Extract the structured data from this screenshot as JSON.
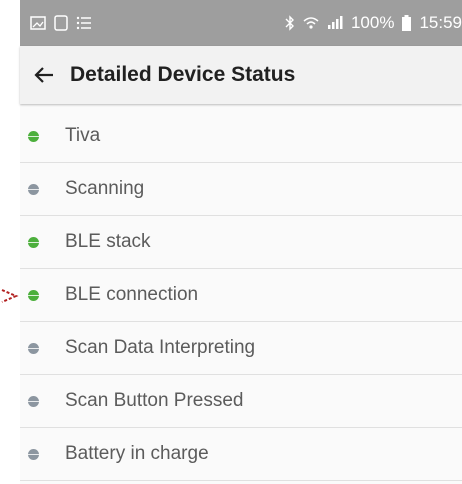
{
  "statusbar": {
    "battery": "100%",
    "time": "15:59",
    "icons_left": [
      "image-icon",
      "notification-icon",
      "menu-list-icon"
    ],
    "icons_right": [
      "bluetooth-icon",
      "wifi-icon",
      "signal-icon",
      "battery-icon"
    ]
  },
  "appbar": {
    "title": "Detailed Device Status",
    "back_icon": "back-arrow-icon"
  },
  "colors": {
    "active": "#4caf3c",
    "inactive": "#8c96a0",
    "pointer": "#b22222"
  },
  "items": [
    {
      "label": "Tiva",
      "status": "active"
    },
    {
      "label": "Scanning",
      "status": "inactive"
    },
    {
      "label": "BLE stack",
      "status": "active"
    },
    {
      "label": "BLE connection",
      "status": "active"
    },
    {
      "label": "Scan Data Interpreting",
      "status": "inactive"
    },
    {
      "label": "Scan Button Pressed",
      "status": "inactive"
    },
    {
      "label": "Battery in charge",
      "status": "inactive"
    }
  ]
}
